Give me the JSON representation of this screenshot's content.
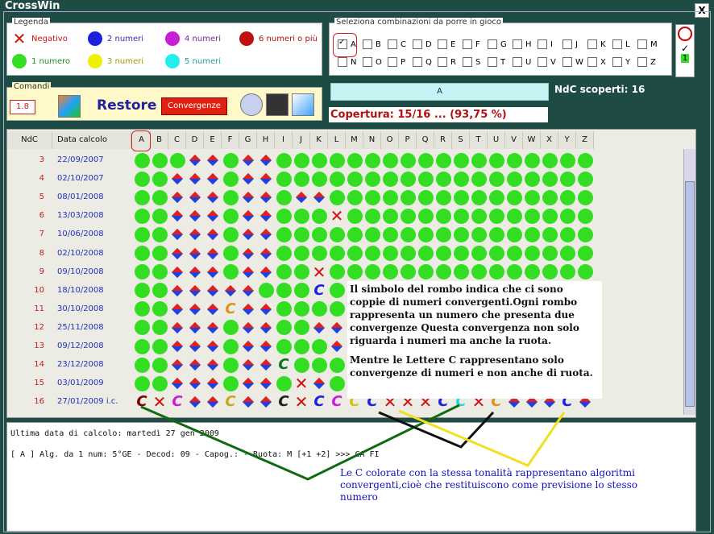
{
  "window": {
    "title": "CrossWin",
    "close_label": "X"
  },
  "legend": {
    "title": "Legenda",
    "items": [
      {
        "label": "Negativo",
        "kind": "x"
      },
      {
        "label": "2 numeri",
        "color": "#1a22e0"
      },
      {
        "label": "4 numeri",
        "color": "#c81ed8"
      },
      {
        "label": "6 numeri o più",
        "color": "#c01010"
      },
      {
        "label": "1 numero",
        "color": "#33dd22"
      },
      {
        "label": "3 numeri",
        "color": "#eef000"
      },
      {
        "label": "5 numeri",
        "color": "#22eeee"
      }
    ]
  },
  "combinations": {
    "title": "Seleziona combinazioni da porre in gioco",
    "row1": [
      "A",
      "B",
      "C",
      "D",
      "E",
      "F",
      "G",
      "H",
      "I",
      "J",
      "K",
      "L",
      "M"
    ],
    "row2": [
      "N",
      "O",
      "P",
      "Q",
      "R",
      "S",
      "T",
      "U",
      "V",
      "W",
      "X",
      "Y",
      "Z"
    ],
    "checked": [
      "A"
    ],
    "side_number": "1"
  },
  "comandi": {
    "title": "Comandi",
    "value": "1.8",
    "restore_label": "Restore",
    "convergenze_label": "Convergenze"
  },
  "status": {
    "selected": "A",
    "ndc_scoperti": "NdC scoperti: 16",
    "copertura": "Copertura: 15/16 ... (93,75 %)"
  },
  "grid": {
    "headers": {
      "ndc": "NdC",
      "date": "Data calcolo"
    },
    "columns": [
      "A",
      "B",
      "C",
      "D",
      "E",
      "F",
      "G",
      "H",
      "I",
      "J",
      "K",
      "L",
      "M",
      "N",
      "O",
      "P",
      "Q",
      "R",
      "S",
      "T",
      "U",
      "V",
      "W",
      "X",
      "Y",
      "Z"
    ],
    "rows": [
      {
        "n": "3",
        "date": "22/09/2007"
      },
      {
        "n": "4",
        "date": "02/10/2007"
      },
      {
        "n": "5",
        "date": "08/01/2008"
      },
      {
        "n": "6",
        "date": "13/03/2008"
      },
      {
        "n": "7",
        "date": "10/06/2008"
      },
      {
        "n": "8",
        "date": "02/10/2008"
      },
      {
        "n": "9",
        "date": "09/10/2008"
      },
      {
        "n": "10",
        "date": "18/10/2008"
      },
      {
        "n": "11",
        "date": "30/10/2008"
      },
      {
        "n": "12",
        "date": "25/11/2008"
      },
      {
        "n": "13",
        "date": "09/12/2008"
      },
      {
        "n": "14",
        "date": "23/12/2008"
      },
      {
        "n": "15",
        "date": "03/01/2009"
      },
      {
        "n": "16",
        "date": "27/01/2009 i.c."
      }
    ],
    "cells": [
      "GGGDDGDDGGGGGGGGGGGGGGGGGG",
      "GGDDDGDDGGGGGGGGGGGGGGGGGG",
      "GGDDDGDDGDDGGGGGGGGGGGGGGG",
      "GGDDDGDDGGGXGGGGGGGGGGGGGG",
      "GGDDDGDDGGGGGGGGGGGGGGGGGG",
      "GGDDDGDDGGGGGGGGGGGGGGGGGG",
      "GGDDDGDDGGXGGGGGGGGGGGGGGG",
      "GGDDDDDGGGCGGGGGGGGGGGGCXX",
      "GGDDDCDDGGGGGGGGGGGGGGGGGC",
      "GGDDDGDDGGDDDGDDDGGXGGGGGG",
      "GGDDDGDDGGGDGGDDDGGGGGDDGG",
      "GGDDDGDDCGGGGGXGGGGGXDGGGC",
      "GGDDDGDDGXDGGGGGGGGGGGGGGG",
      "CXCDDCDDCXCCCCXXXCCXCDDDCD"
    ],
    "c_colors": [
      "#1a22e0",
      "#22d8d8",
      "#e09020",
      "#1a22e0",
      "#107020",
      "#107020",
      "#800000",
      "#c81ed8",
      "#c8a820",
      "#202020",
      "#1a22e0",
      "#c81ed8",
      "#d8c020",
      "#1a22e0"
    ]
  },
  "annotations": {
    "rhombus_note": "Il simbolo del rombo indica che ci sono coppie di numeri convergenti.Ogni rombo rappresenta un numero che presenta due convergenze Questa convergenza non solo riguarda i numeri ma anche la ruota.",
    "c_note": "Mentre le Lettere C rappresentano solo convergenze di numeri e non anche di ruota.",
    "bottom_note": "Le C colorate con la stessa tonalità rappresentano algoritmi convergenti,cioè che restituiscono come previsione lo stesso numero"
  },
  "log": {
    "line1": "Ultima data di calcolo: martedì 27 gen 2009",
    "line2": "[ A ] Alg. da 1 num:  5°GE - Decod: 09 - Capog.:  - Ruota: M [+1 +2] >>> CA FI"
  }
}
